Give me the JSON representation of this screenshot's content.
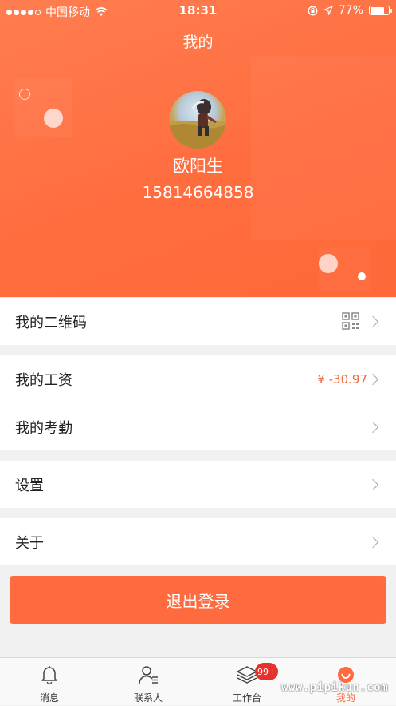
{
  "status_bar": {
    "carrier": "中国移动",
    "time": "18:31",
    "battery_percent_text": "77%",
    "battery_level": 0.77
  },
  "header": {
    "title": "我的"
  },
  "profile": {
    "name": "欧阳生",
    "phone": "15814664858"
  },
  "menu": {
    "qr_code": {
      "label": "我的二维码",
      "icon": "qr-code-icon"
    },
    "salary": {
      "label": "我的工资",
      "value": "¥ -30.97"
    },
    "attendance": {
      "label": "我的考勤"
    },
    "settings": {
      "label": "设置"
    },
    "about": {
      "label": "关于"
    }
  },
  "logout": {
    "label": "退出登录"
  },
  "tabbar": {
    "items": [
      {
        "label": "消息",
        "icon": "bell-icon"
      },
      {
        "label": "联系人",
        "icon": "contacts-icon"
      },
      {
        "label": "工作台",
        "icon": "layers-icon",
        "badge": "99+"
      },
      {
        "label": "我的",
        "icon": "smile-icon",
        "active": true
      }
    ]
  },
  "watermark": "www.pipikun.com",
  "colors": {
    "accent": "#ff6b3f",
    "salary_value": "#f06a3c",
    "badge": "#e5322d"
  }
}
